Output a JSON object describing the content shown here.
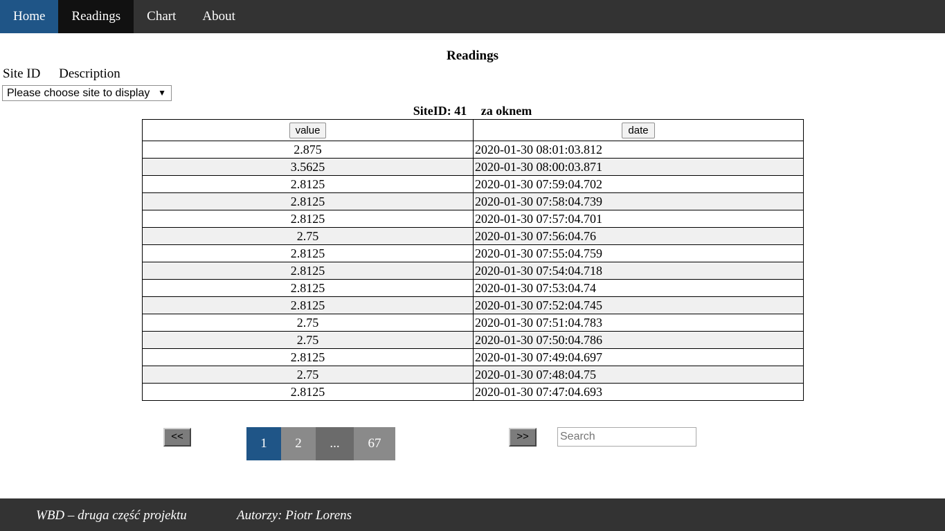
{
  "nav": {
    "items": [
      {
        "label": "Home"
      },
      {
        "label": "Readings"
      },
      {
        "label": "Chart"
      },
      {
        "label": "About"
      }
    ]
  },
  "page": {
    "title": "Readings"
  },
  "filter": {
    "site_id_label": "Site ID",
    "description_label": "Description",
    "select_value": "Please choose site to display",
    "select_arrow": "▼"
  },
  "site": {
    "caption_prefix": "SiteID: 41",
    "description": "za oknem"
  },
  "table": {
    "columns": [
      "value",
      "date"
    ],
    "rows": [
      {
        "value": "2.875",
        "date": "2020-01-30 08:01:03.812"
      },
      {
        "value": "3.5625",
        "date": "2020-01-30 08:00:03.871"
      },
      {
        "value": "2.8125",
        "date": "2020-01-30 07:59:04.702"
      },
      {
        "value": "2.8125",
        "date": "2020-01-30 07:58:04.739"
      },
      {
        "value": "2.8125",
        "date": "2020-01-30 07:57:04.701"
      },
      {
        "value": "2.75",
        "date": "2020-01-30 07:56:04.76"
      },
      {
        "value": "2.8125",
        "date": "2020-01-30 07:55:04.759"
      },
      {
        "value": "2.8125",
        "date": "2020-01-30 07:54:04.718"
      },
      {
        "value": "2.8125",
        "date": "2020-01-30 07:53:04.74"
      },
      {
        "value": "2.8125",
        "date": "2020-01-30 07:52:04.745"
      },
      {
        "value": "2.75",
        "date": "2020-01-30 07:51:04.783"
      },
      {
        "value": "2.75",
        "date": "2020-01-30 07:50:04.786"
      },
      {
        "value": "2.8125",
        "date": "2020-01-30 07:49:04.697"
      },
      {
        "value": "2.75",
        "date": "2020-01-30 07:48:04.75"
      },
      {
        "value": "2.8125",
        "date": "2020-01-30 07:47:04.693"
      }
    ]
  },
  "pagination": {
    "prev_label": "<<",
    "next_label": ">>",
    "pages": [
      "1",
      "2",
      "...",
      "67"
    ],
    "current": "1"
  },
  "search": {
    "placeholder": "Search"
  },
  "footer": {
    "project": "WBD – druga część projektu",
    "authors": "Autorzy: Piotr Lorens"
  },
  "colors": {
    "nav_bg": "#333333",
    "accent": "#1f5587",
    "active_nav": "#111111",
    "row_alt": "#f0f0f0"
  }
}
